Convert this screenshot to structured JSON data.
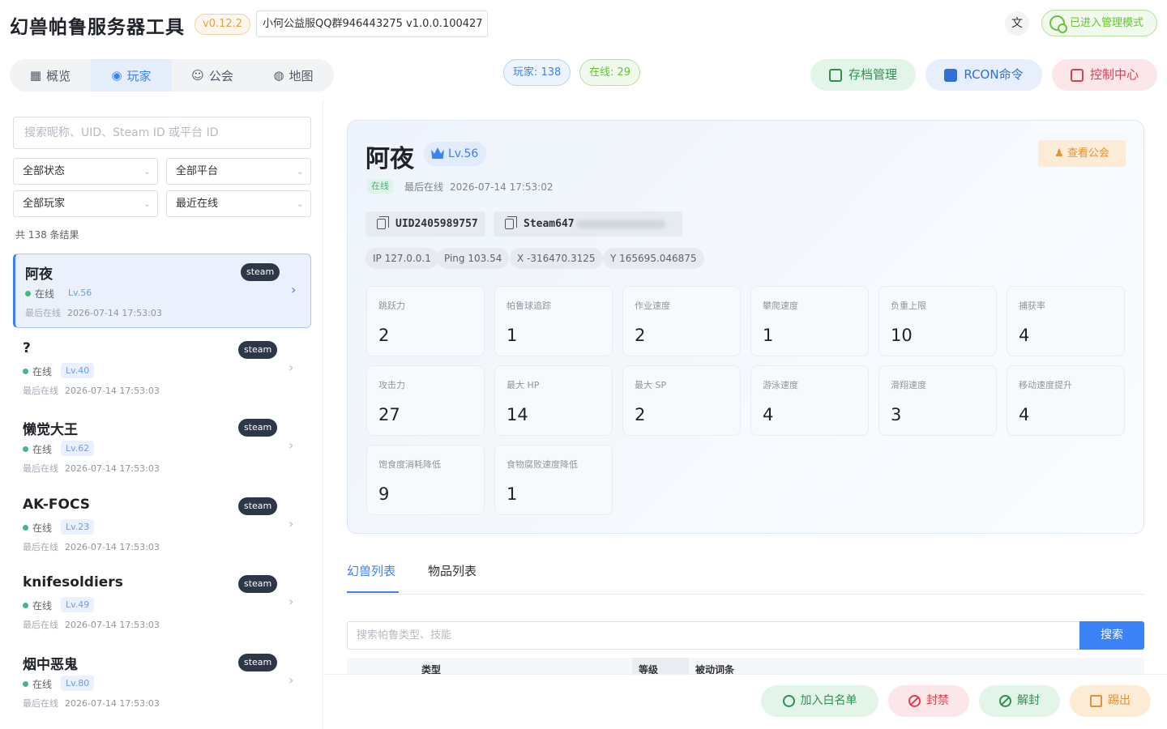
{
  "header": {
    "title": "幻兽帕鲁服务器工具",
    "version": "v0.12.2",
    "server_name": "小何公益服QQ群946443275 v1.0.0.100427",
    "translate_icon": "translate-icon",
    "admin_mode": "已进入管理模式"
  },
  "nav": {
    "tabs": [
      {
        "label": "概览",
        "icon": "grid-icon"
      },
      {
        "label": "玩家",
        "icon": "gamepad-icon"
      },
      {
        "label": "公会",
        "icon": "guild-icon"
      },
      {
        "label": "地图",
        "icon": "globe-icon"
      }
    ],
    "active": "玩家"
  },
  "counts": {
    "players": "玩家: 138",
    "online": "在线: 29"
  },
  "actions": {
    "archive": "存档管理",
    "rcon": "RCON命令",
    "control": "控制中心"
  },
  "filters": {
    "search_placeholder": "搜索昵称、UID、Steam ID 或平台 ID",
    "status": "全部状态",
    "platform": "全部平台",
    "players": "全部玩家",
    "sort": "最近在线",
    "result_count": "共 138 条结果"
  },
  "player_list": [
    {
      "name": "阿夜",
      "platform": "steam",
      "status": "在线",
      "level": "Lv.56",
      "last_label": "最后在线",
      "last_online": "2026-07-14 17:53:03"
    },
    {
      "name": "?",
      "platform": "steam",
      "status": "在线",
      "level": "Lv.40",
      "last_label": "最后在线",
      "last_online": "2026-07-14 17:53:03"
    },
    {
      "name": "懒觉大王",
      "platform": "steam",
      "status": "在线",
      "level": "Lv.62",
      "last_label": "最后在线",
      "last_online": "2026-07-14 17:53:03"
    },
    {
      "name": "AK-FOCS",
      "platform": "steam",
      "status": "在线",
      "level": "Lv.23",
      "last_label": "最后在线",
      "last_online": "2026-07-14 17:53:03"
    },
    {
      "name": "knifesoldiers",
      "platform": "steam",
      "status": "在线",
      "level": "Lv.49",
      "last_label": "最后在线",
      "last_online": "2026-07-14 17:53:03"
    },
    {
      "name": "烟中恶鬼",
      "platform": "steam",
      "status": "在线",
      "level": "Lv.80",
      "last_label": "最后在线",
      "last_online": "2026-07-14 17:53:03"
    }
  ],
  "detail": {
    "name": "阿夜",
    "level": "Lv.56",
    "view_guild": "查看公会",
    "status": "在线",
    "last_label": "最后在线",
    "last_online": "2026-07-14 17:53:02",
    "uid": "UID2405989757",
    "steam_prefix": "Steam647",
    "ip": "IP 127.0.0.1",
    "ping": "Ping 103.54",
    "x": "X -316470.3125",
    "y": "Y 165695.046875",
    "stats": [
      {
        "label": "跳跃力",
        "value": "2"
      },
      {
        "label": "帕鲁球追踪",
        "value": "1"
      },
      {
        "label": "作业速度",
        "value": "2"
      },
      {
        "label": "攀爬速度",
        "value": "1"
      },
      {
        "label": "负重上限",
        "value": "10"
      },
      {
        "label": "捕获率",
        "value": "4"
      },
      {
        "label": "攻击力",
        "value": "27"
      },
      {
        "label": "最大 HP",
        "value": "14"
      },
      {
        "label": "最大 SP",
        "value": "2"
      },
      {
        "label": "游泳速度",
        "value": "4"
      },
      {
        "label": "滑翔速度",
        "value": "3"
      },
      {
        "label": "移动速度提升",
        "value": "4"
      },
      {
        "label": "饱食度消耗降低",
        "value": "9"
      },
      {
        "label": "食物腐败速度降低",
        "value": "1"
      }
    ]
  },
  "tabs": {
    "pals": "幻兽列表",
    "items": "物品列表"
  },
  "pal_search": {
    "placeholder": "搜索帕鲁类型、技能",
    "button": "搜索"
  },
  "table": {
    "col_type": "类型",
    "col_level": "等级",
    "col_passive": "被动词条"
  },
  "bottom_actions": {
    "whitelist": "加入白名单",
    "ban": "封禁",
    "unban": "解封",
    "kick": "踢出"
  },
  "colors": {
    "accent": "#3b82f6",
    "online": "#42b883",
    "danger": "#d94052",
    "success": "#2f8f52",
    "warning": "#e3923a"
  }
}
